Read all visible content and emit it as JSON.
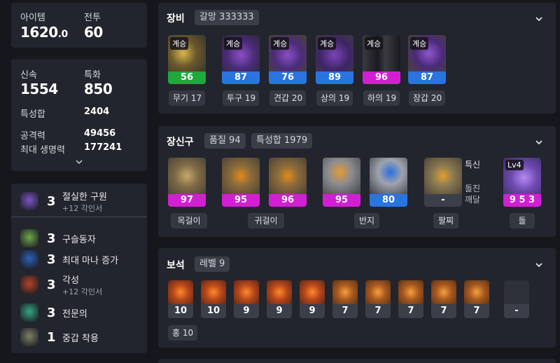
{
  "left": {
    "top": {
      "item_level_label": "아이템",
      "item_level_main": "1620",
      "item_level_dec": ".0",
      "combat_label": "전투",
      "combat_value": "60"
    },
    "stats": {
      "swift_label": "신속",
      "swift_value": "1554",
      "spec_label": "특화",
      "spec_value": "850",
      "total_label": "특성합",
      "total_value": "2404",
      "attack_label": "공격력",
      "attack_value": "49456",
      "hp_label": "최대 생명력",
      "hp_value": "177241"
    },
    "engravings": [
      {
        "level": "3",
        "name": "절실한 구원",
        "sub": "+12 각인서",
        "icon": "engraving-icon",
        "color": "#7b55c8"
      },
      {
        "level": "3",
        "name": "구슬동자",
        "sub": "",
        "icon": "engraving-icon",
        "color": "#6fa84a"
      },
      {
        "level": "3",
        "name": "최대 마나 증가",
        "sub": "",
        "icon": "engraving-icon",
        "color": "#2f5fb5"
      },
      {
        "level": "3",
        "name": "각성",
        "sub": "+12 각인서",
        "icon": "engraving-icon",
        "color": "#b54328"
      },
      {
        "level": "3",
        "name": "전문의",
        "sub": "",
        "icon": "engraving-icon",
        "color": "#34a584"
      },
      {
        "level": "1",
        "name": "중갑 착용",
        "sub": "",
        "icon": "engraving-icon",
        "color": "#7e8068"
      }
    ]
  },
  "equipment": {
    "title": "장비",
    "chip": "갈망 333333",
    "items": [
      {
        "tag": "계승",
        "quality": "56",
        "bar_color": "#1fa83c",
        "label": "무기 17"
      },
      {
        "tag": "계승",
        "quality": "87",
        "bar_color": "#2a74e0",
        "label": "투구 19"
      },
      {
        "tag": "계승",
        "quality": "76",
        "bar_color": "#2a74e0",
        "label": "견갑 20"
      },
      {
        "tag": "계승",
        "quality": "89",
        "bar_color": "#2a74e0",
        "label": "상의 19"
      },
      {
        "tag": "계승",
        "quality": "96",
        "bar_color": "#d31fd3",
        "label": "하의 19"
      },
      {
        "tag": "계승",
        "quality": "87",
        "bar_color": "#2a74e0",
        "label": "장갑 20"
      }
    ]
  },
  "accessories": {
    "title": "장신구",
    "chip_quality": "품질 94",
    "chip_total": "특성합 1979",
    "items": [
      {
        "quality": "97",
        "bar_color": "#d31fd3"
      },
      {
        "quality": "95",
        "bar_color": "#d31fd3"
      },
      {
        "quality": "96",
        "bar_color": "#d31fd3"
      },
      {
        "quality": "95",
        "bar_color": "#d31fd3"
      },
      {
        "quality": "80",
        "bar_color": "#2a74e0"
      },
      {
        "quality": "-",
        "bar_color": "#3b3f49"
      },
      {
        "quality": "9 5 3",
        "bar_color": "#d31fd3"
      }
    ],
    "bracelet_text1": "특신",
    "bracelet_text2": "돌진",
    "bracelet_text3": "깨달",
    "stone_tag": "Lv4",
    "labels": [
      "목걸이",
      "귀걸이",
      "반지",
      "팔찌",
      "돌"
    ]
  },
  "gems": {
    "title": "보석",
    "chip": "레벨 9",
    "values": [
      "10",
      "10",
      "9",
      "9",
      "9",
      "7",
      "7",
      "7",
      "7",
      "7",
      "-"
    ],
    "summary": "홍 10"
  }
}
